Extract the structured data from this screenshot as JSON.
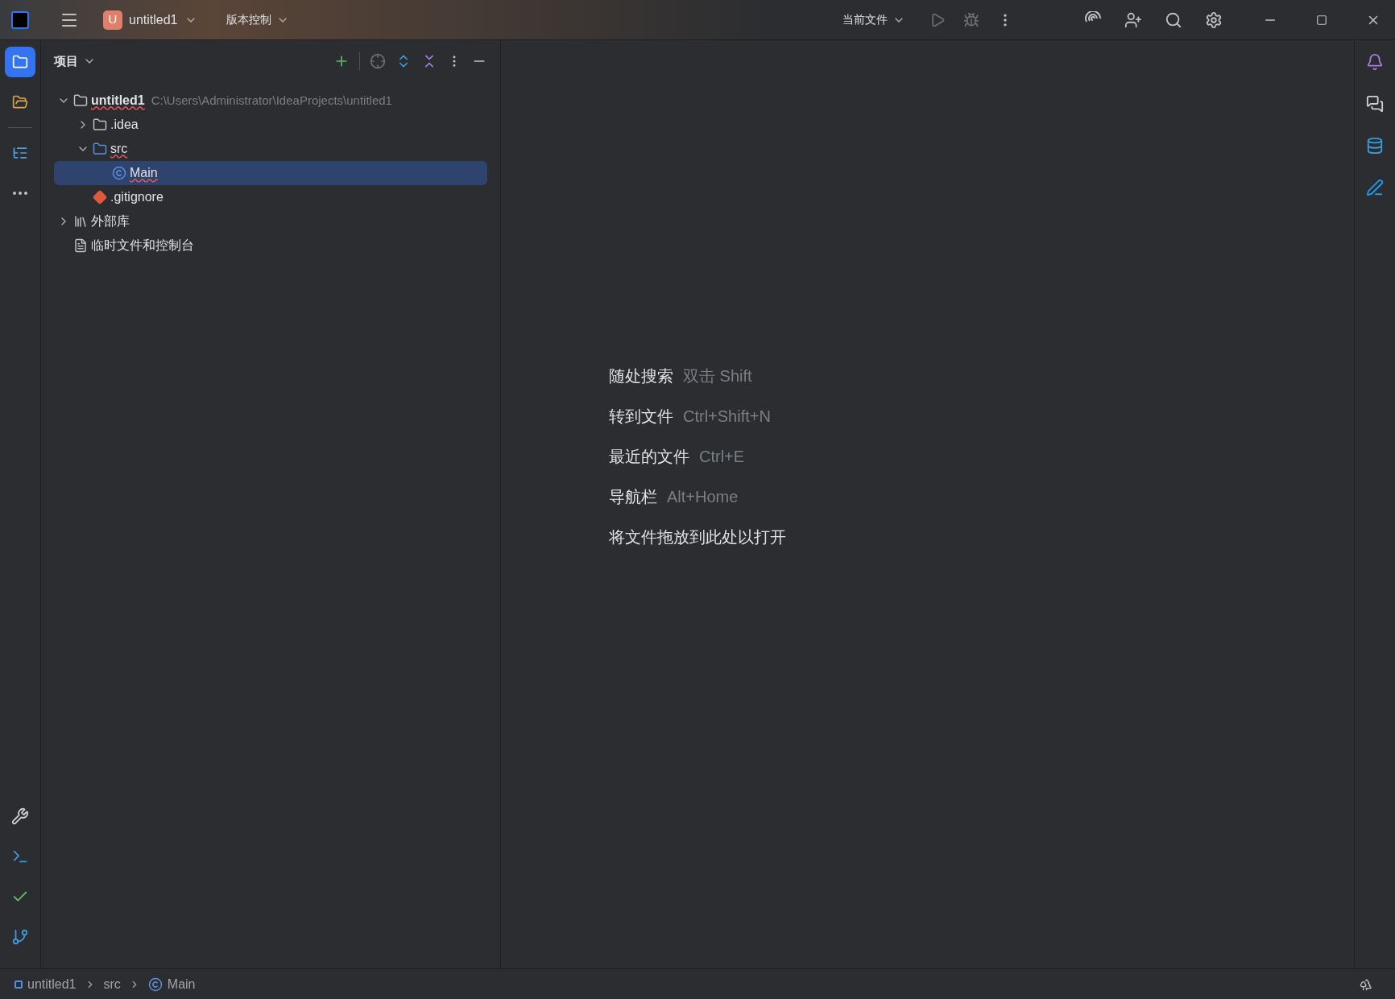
{
  "title_bar": {
    "project_badge": "U",
    "project_name": "untitled1",
    "vcs_menu": "版本控制",
    "run_config": "当前文件"
  },
  "left_toolbar": {
    "top": [
      {
        "kind": "project",
        "selected": true
      },
      {
        "kind": "folder",
        "selected": false
      },
      {
        "kind": "structure",
        "selected": false
      },
      {
        "kind": "more",
        "selected": false
      }
    ],
    "bottom": [
      {
        "kind": "services"
      },
      {
        "kind": "terminal"
      },
      {
        "kind": "problems"
      },
      {
        "kind": "git"
      }
    ]
  },
  "project_panel": {
    "title": "项目",
    "tree": [
      {
        "kind": "project",
        "label": "untitled1",
        "path": "C:\\Users\\Administrator\\IdeaProjects\\untitled1",
        "error": true,
        "expanded": true,
        "selected": false,
        "children": [
          {
            "kind": "idea-folder",
            "label": ".idea",
            "error": false,
            "expanded": false,
            "selected": false
          },
          {
            "kind": "folder",
            "label": "src",
            "error": true,
            "expanded": true,
            "selected": false,
            "children": [
              {
                "kind": "class",
                "label": "Main",
                "error": true,
                "selected": true
              }
            ]
          },
          {
            "kind": "git",
            "label": ".gitignore",
            "error": false,
            "selected": false
          }
        ]
      },
      {
        "kind": "library",
        "label": "外部库",
        "error": false,
        "expanded": false,
        "selected": false
      },
      {
        "kind": "scratch",
        "label": "临时文件和控制台",
        "error": false,
        "selected": false
      }
    ]
  },
  "editor_hints": [
    {
      "label": "随处搜索",
      "shortcut": "双击 Shift"
    },
    {
      "label": "转到文件",
      "shortcut": "Ctrl+Shift+N"
    },
    {
      "label": "最近的文件",
      "shortcut": "Ctrl+E"
    },
    {
      "label": "导航栏",
      "shortcut": "Alt+Home"
    },
    {
      "label": "将文件拖放到此处以打开"
    }
  ],
  "right_toolbar": [
    {
      "kind": "notifications"
    },
    {
      "kind": "ai-chat"
    },
    {
      "kind": "database"
    },
    {
      "kind": "edit"
    }
  ],
  "status_bar": {
    "breadcrumbs": [
      {
        "kind": "module",
        "label": "untitled1"
      },
      {
        "kind": "folder",
        "label": "src"
      },
      {
        "kind": "class",
        "label": "Main"
      }
    ]
  }
}
